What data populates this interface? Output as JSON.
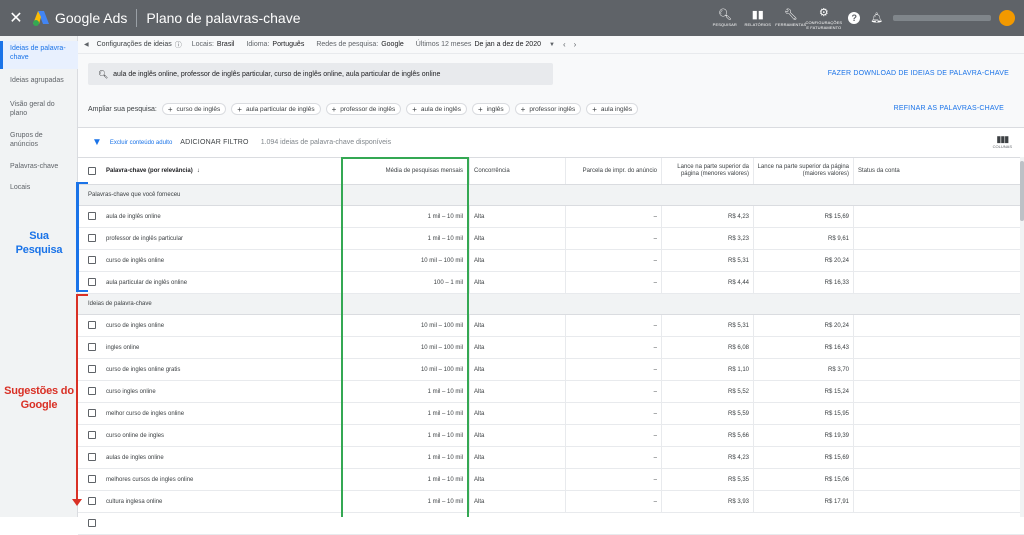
{
  "topbar": {
    "brand": "Google Ads",
    "title": "Plano de palavras-chave",
    "tools": [
      {
        "icon": "search-icon",
        "label": "PESQUISAR"
      },
      {
        "icon": "bar-chart-icon",
        "label": "RELATÓRIOS"
      },
      {
        "icon": "wrench-icon",
        "label": "FERRAMENTAS"
      },
      {
        "icon": "gear-icon",
        "label": "CONFIGURAÇÕES E FATURAMENTO"
      }
    ]
  },
  "sidebar": {
    "items": [
      "Ideias de palavra-chave",
      "Ideias agrupadas",
      "Visão geral do plano",
      "Grupos de anúncios",
      "Palavras-chave",
      "Locais"
    ]
  },
  "settings_bar": {
    "config": "Configurações de ideias",
    "locations_label": "Locais:",
    "locations_value": "Brasil",
    "language_label": "Idioma:",
    "language_value": "Português",
    "network_label": "Redes de pesquisa:",
    "network_value": "Google",
    "period_label": "Últimos 12 meses",
    "period_value": "De jan a dez de 2020"
  },
  "search": {
    "query": "aula de inglês online, professor de inglês particular, curso de inglês online, aula particular de inglês online",
    "download": "FAZER DOWNLOAD DE IDEIAS DE PALAVRA-CHAVE"
  },
  "broaden": {
    "label": "Ampliar sua pesquisa:",
    "chips": [
      "curso de inglês",
      "aula particular de inglês",
      "professor de inglês",
      "aula de inglês",
      "inglês",
      "professor inglês",
      "aula inglês"
    ],
    "refine": "REFINAR AS PALAVRAS-CHAVE"
  },
  "filter": {
    "exclude": "Excluir conteúdo adulto",
    "add": "ADICIONAR FILTRO",
    "count": "1.094 ideias de palavra-chave disponíveis",
    "columns": "COLUNAS"
  },
  "table": {
    "headers": {
      "keyword": "Palavra-chave (por relevância)",
      "searches": "Média de pesquisas mensais",
      "competition": "Concorrência",
      "impr": "Parcela de impr. do anúncio",
      "low_bid": "Lance na parte superior da página (menores valores)",
      "high_bid": "Lance na parte superior da página (maiores valores)",
      "status": "Status da conta"
    },
    "group1": "Palavras-chave que você forneceu",
    "group2": "Ideias de palavra-chave",
    "provided": [
      {
        "kw": "aula de inglês online",
        "s": "1 mil – 10 mil",
        "comp": "Alta",
        "impr": "–",
        "low": "R$ 4,23",
        "high": "R$ 15,69"
      },
      {
        "kw": "professor de inglês particular",
        "s": "1 mil – 10 mil",
        "comp": "Alta",
        "impr": "–",
        "low": "R$ 3,23",
        "high": "R$ 9,61"
      },
      {
        "kw": "curso de inglês online",
        "s": "10 mil – 100 mil",
        "comp": "Alta",
        "impr": "–",
        "low": "R$ 5,31",
        "high": "R$ 20,24"
      },
      {
        "kw": "aula particular de inglês online",
        "s": "100 – 1 mil",
        "comp": "Alta",
        "impr": "–",
        "low": "R$ 4,44",
        "high": "R$ 16,33"
      }
    ],
    "ideas": [
      {
        "kw": "curso de ingles online",
        "s": "10 mil – 100 mil",
        "comp": "Alta",
        "impr": "–",
        "low": "R$ 5,31",
        "high": "R$ 20,24"
      },
      {
        "kw": "ingles online",
        "s": "10 mil – 100 mil",
        "comp": "Alta",
        "impr": "–",
        "low": "R$ 6,08",
        "high": "R$ 16,43"
      },
      {
        "kw": "curso de ingles online gratis",
        "s": "10 mil – 100 mil",
        "comp": "Alta",
        "impr": "–",
        "low": "R$ 1,10",
        "high": "R$ 3,70"
      },
      {
        "kw": "curso ingles online",
        "s": "1 mil – 10 mil",
        "comp": "Alta",
        "impr": "–",
        "low": "R$ 5,52",
        "high": "R$ 15,24"
      },
      {
        "kw": "melhor curso de ingles online",
        "s": "1 mil – 10 mil",
        "comp": "Alta",
        "impr": "–",
        "low": "R$ 5,59",
        "high": "R$ 15,95"
      },
      {
        "kw": "curso online de ingles",
        "s": "1 mil – 10 mil",
        "comp": "Alta",
        "impr": "–",
        "low": "R$ 5,66",
        "high": "R$ 19,39"
      },
      {
        "kw": "aulas de ingles online",
        "s": "1 mil – 10 mil",
        "comp": "Alta",
        "impr": "–",
        "low": "R$ 4,23",
        "high": "R$ 15,69"
      },
      {
        "kw": "melhores cursos de ingles online",
        "s": "1 mil – 10 mil",
        "comp": "Alta",
        "impr": "–",
        "low": "R$ 5,35",
        "high": "R$ 15,06"
      },
      {
        "kw": "cultura inglesa online",
        "s": "1 mil – 10 mil",
        "comp": "Alta",
        "impr": "–",
        "low": "R$ 3,93",
        "high": "R$ 17,91"
      }
    ]
  },
  "annotations": {
    "yours": "Sua Pesquisa",
    "google": "Sugestões do Google"
  },
  "colors": {
    "topbar": "#5f6368",
    "accent": "#1a73e8",
    "annotation_blue": "#1a73e8",
    "annotation_red": "#d93025",
    "highlight_green": "#34a853"
  }
}
